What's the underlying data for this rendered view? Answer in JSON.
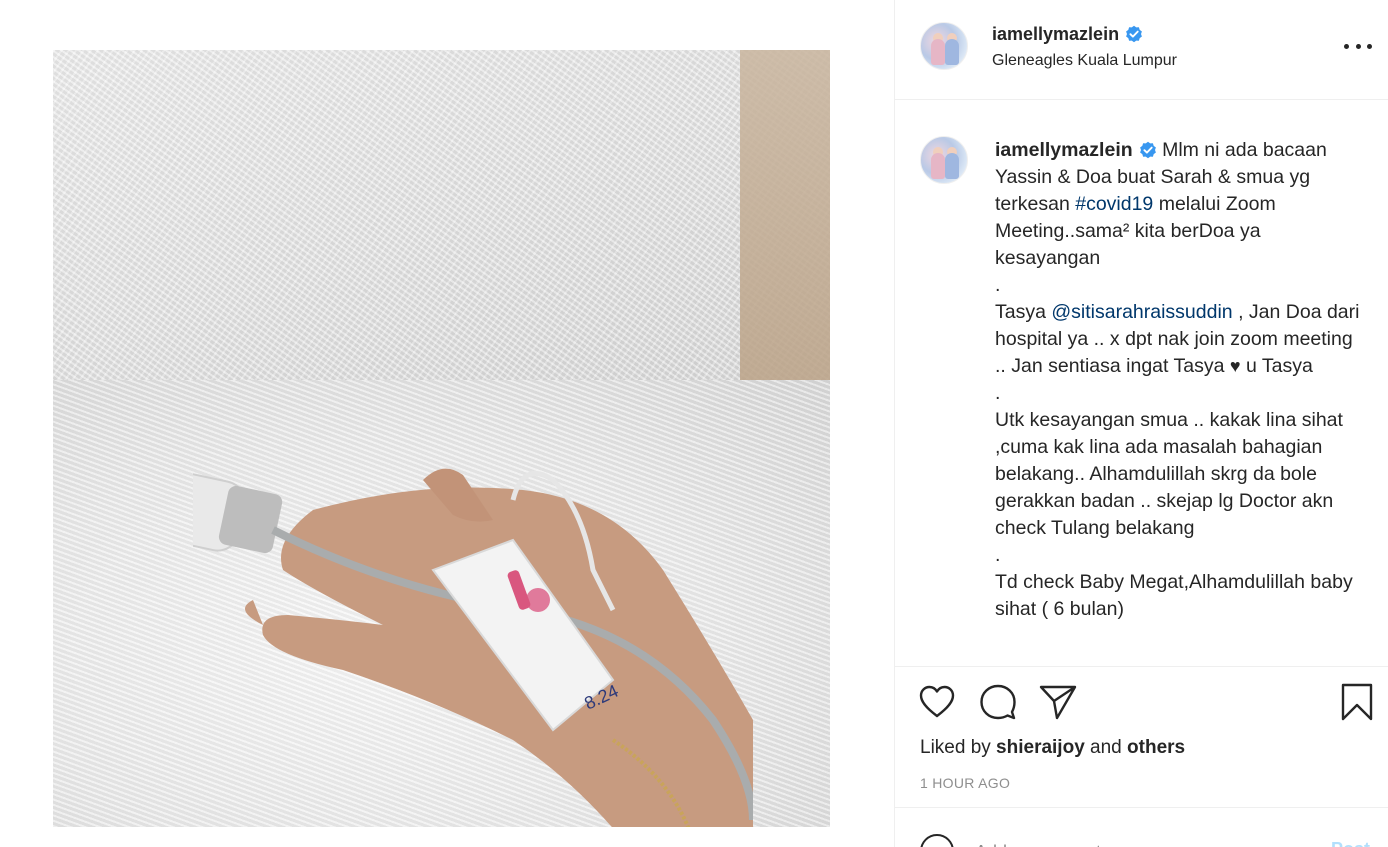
{
  "header": {
    "username": "iamellymazlein",
    "location": "Gleneagles Kuala Lumpur"
  },
  "caption": {
    "username": "iamellymazlein",
    "line1_text": " Mlm ni ada bacaan Yassin & Doa buat Sarah & smua yg terkesan ",
    "hashtag": "#covid19",
    "line1_after": " melalui Zoom Meeting..sama² kita berDoa ya kesayangan",
    "dot1": ".",
    "p2_before": "Tasya ",
    "mention": "@sitisarahraissuddin",
    "p2_after": " , Jan Doa dari hospital ya .. x dpt nak join zoom meeting .. Jan sentiasa ingat Tasya ",
    "heart": "♥",
    "p2_end": " u Tasya",
    "dot2": ".",
    "p3": "Utk kesayangan smua .. kakak lina sihat ,cuma kak lina ada masalah bahagian belakang.. Alhamdulillah skrg da bole gerakkan badan .. skejap lg Doctor akn check Tulang belakang",
    "dot3": ".",
    "p4": "Td check Baby Megat,Alhamdulillah baby sihat ( 6 bulan)"
  },
  "likes": {
    "prefix": "Liked by ",
    "user": "shieraijoy",
    "middle": " and ",
    "others": "others"
  },
  "timestamp": "1 HOUR AGO",
  "comment": {
    "placeholder": "Add a comment...",
    "post_label": "Post"
  },
  "colors": {
    "verified": "#3897f0",
    "link": "#00376b",
    "muted": "#8e8e8e",
    "post_disabled": "#b2dffc"
  }
}
